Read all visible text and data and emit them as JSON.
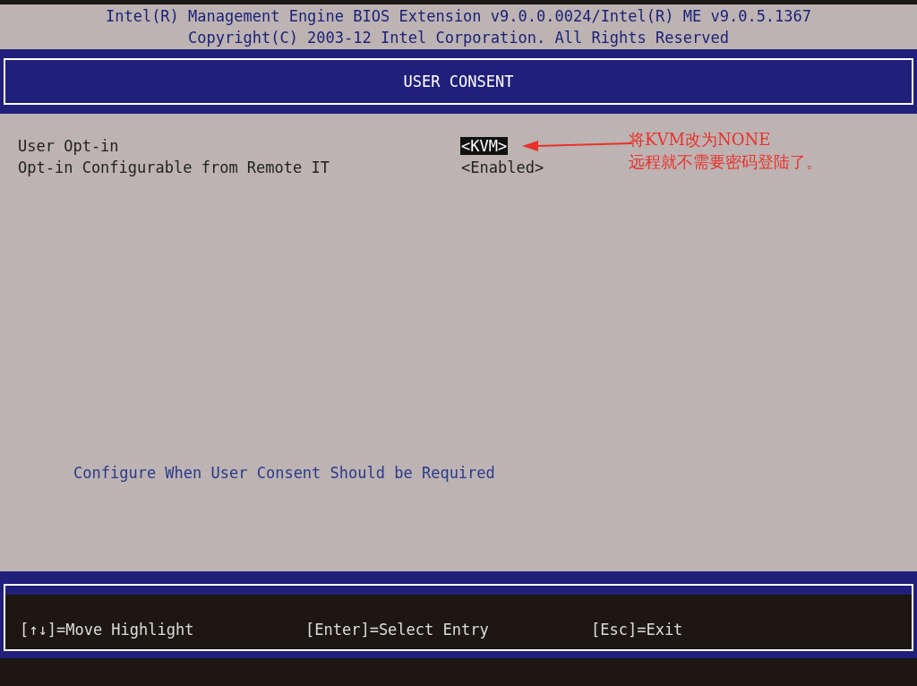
{
  "header": {
    "lines": [
      "Intel(R) Management Engine BIOS Extension v9.0.0.0024/Intel(R) ME v9.0.5.1367",
      "Copyright(C) 2003-12 Intel Corporation. All Rights Reserved"
    ]
  },
  "title": "USER CONSENT",
  "settings": [
    {
      "label": "User Opt-in",
      "value": "<KVM>",
      "selected": true
    },
    {
      "label": "Opt-in Configurable from Remote IT",
      "value": "<Enabled>",
      "selected": false
    }
  ],
  "annotation": {
    "lines": [
      "将KVM改为NONE",
      "远程就不需要密码登陆了。"
    ]
  },
  "help_text": "Configure When User Consent Should be Required",
  "footer": [
    "[↑↓]=Move Highlight",
    "[Enter]=Select Entry",
    "[Esc]=Exit"
  ]
}
